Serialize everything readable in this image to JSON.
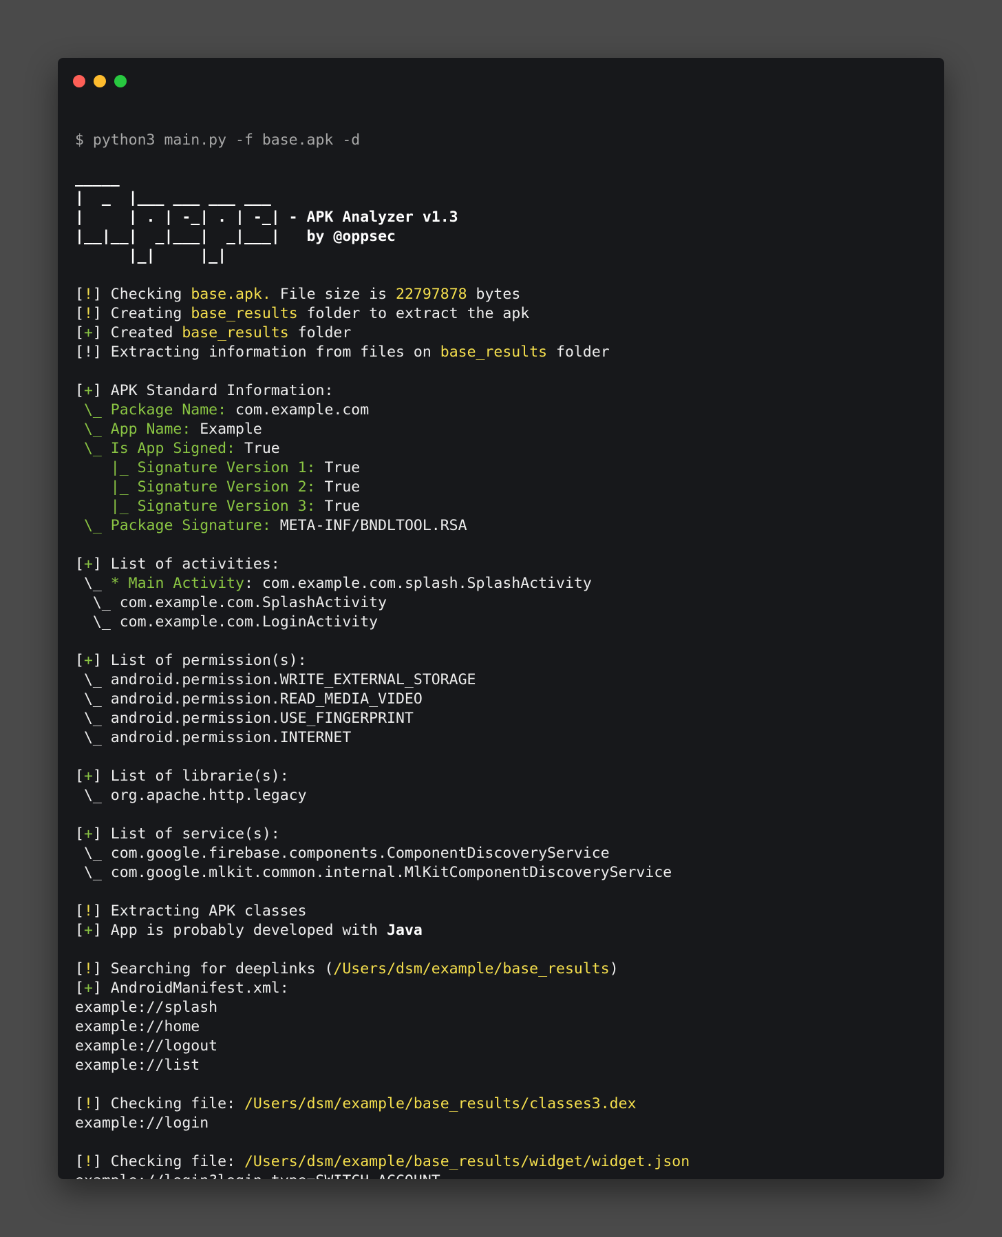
{
  "colors": {
    "background": "#4a4a4a",
    "terminal_bg": "#17181b",
    "text": "#ededed",
    "prompt": "#a7a7a7",
    "yellow": "#f5df4d",
    "green": "#8ac543",
    "close": "#fe5f57",
    "minimize": "#febc2e",
    "maximize": "#28c840"
  },
  "window_controls": {
    "close": "close-icon",
    "minimize": "minimize-icon",
    "maximize": "maximize-icon"
  },
  "command": "$ python3 main.py -f base.apk -d",
  "banner": {
    "art": [
      "_____",
      "|  _  |___ ___ ___ ___",
      "|     | . | -_| . | -_|",
      "|__|__|  _|___|  _|___|",
      "      |_|     |_|"
    ],
    "title": " - APK Analyzer v1.3",
    "author": "   by @oppsec"
  },
  "checks": {
    "check_prefix": "[",
    "warn": "!",
    "ok": "+",
    "check_suffix": "]",
    "l1_a": " Checking ",
    "l1_file": "base.apk.",
    "l1_b": " File size is ",
    "l1_size": "22797878",
    "l1_c": " bytes",
    "l2_a": " Creating ",
    "l2_folder": "base_results",
    "l2_b": " folder to extract the apk",
    "l3_a": " Created ",
    "l3_folder": "base_results",
    "l3_b": " folder",
    "l4_a": " Extracting information from files on ",
    "l4_folder": "base_results",
    "l4_b": " folder"
  },
  "standard_info": {
    "header": " APK Standard Information:",
    "branch": " \\_ ",
    "sub_branch": "    |_ ",
    "package_label": "Package Name:",
    "package_value": " com.example.com",
    "app_name_label": "App Name:",
    "app_name_value": " Example",
    "signed_label": "Is App Signed:",
    "signed_value": " True",
    "sig_v1_label": "Signature Version 1:",
    "sig_v1_value": " True",
    "sig_v2_label": "Signature Version 2:",
    "sig_v2_value": " True",
    "sig_v3_label": "Signature Version 3:",
    "sig_v3_value": " True",
    "pkg_sig_label": "Package Signature:",
    "pkg_sig_value": " META-INF/BNDLTOOL.RSA"
  },
  "activities": {
    "header": " List of activities:",
    "main_prefix": " \\_ ",
    "main_label": "* Main Activity",
    "main_value": ": com.example.com.splash.SplashActivity",
    "items": [
      "  \\_ com.example.com.SplashActivity",
      "  \\_ com.example.com.LoginActivity"
    ]
  },
  "permissions": {
    "header": " List of permission(s):",
    "items": [
      " \\_ android.permission.WRITE_EXTERNAL_STORAGE",
      " \\_ android.permission.READ_MEDIA_VIDEO",
      " \\_ android.permission.USE_FINGERPRINT",
      " \\_ android.permission.INTERNET"
    ]
  },
  "libraries": {
    "header": " List of librarie(s):",
    "items": [
      " \\_ org.apache.http.legacy"
    ]
  },
  "services": {
    "header": " List of service(s):",
    "items": [
      " \\_ com.google.firebase.components.ComponentDiscoveryService",
      " \\_ com.google.mlkit.common.internal.MlKitComponentDiscoveryService"
    ]
  },
  "classes": {
    "extract": " Extracting APK classes",
    "developed": " App is probably developed with ",
    "language": "Java"
  },
  "deeplinks": {
    "search_a": " Searching for deeplinks (",
    "search_path": "/Users/dsm/example/base_results",
    "search_b": ")",
    "manifest": " AndroidManifest.xml:",
    "manifest_links": [
      "example://splash",
      "example://home",
      "example://logout",
      "example://list"
    ],
    "checking_label": " Checking file: ",
    "file1": "/Users/dsm/example/base_results/classes3.dex",
    "file1_link": "example://login",
    "file2": "/Users/dsm/example/base_results/widget/widget.json",
    "file2_link": "example://login?login_type=SWITCH_ACCOUNT"
  }
}
